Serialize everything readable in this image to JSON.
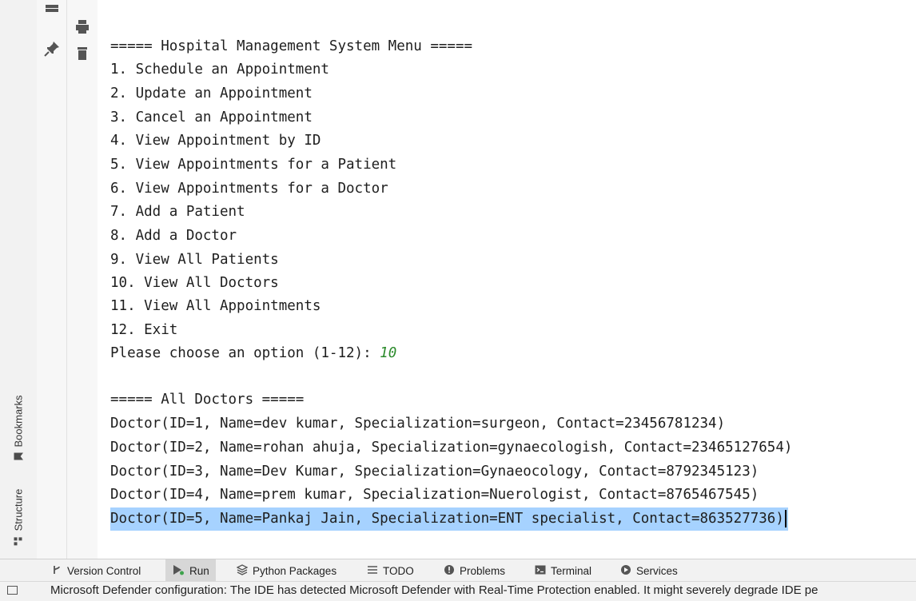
{
  "side_tabs": {
    "bookmarks": "Bookmarks",
    "structure": "Structure"
  },
  "gutter_icons": [
    "layout-icon",
    "pin-icon",
    "print-icon",
    "trash-icon"
  ],
  "console": {
    "lines": [
      {
        "text": "===== Hospital Management System Menu ====="
      },
      {
        "text": "1. Schedule an Appointment"
      },
      {
        "text": "2. Update an Appointment"
      },
      {
        "text": "3. Cancel an Appointment"
      },
      {
        "text": "4. View Appointment by ID"
      },
      {
        "text": "5. View Appointments for a Patient"
      },
      {
        "text": "6. View Appointments for a Doctor"
      },
      {
        "text": "7. Add a Patient"
      },
      {
        "text": "8. Add a Doctor"
      },
      {
        "text": "9. View All Patients"
      },
      {
        "text": "10. View All Doctors"
      },
      {
        "text": "11. View All Appointments"
      },
      {
        "text": "12. Exit"
      },
      {
        "text": "Please choose an option (1-12): ",
        "input": "10"
      },
      {
        "text": ""
      },
      {
        "text": "===== All Doctors ====="
      },
      {
        "text": "Doctor(ID=1, Name=dev kumar, Specialization=surgeon, Contact=23456781234)"
      },
      {
        "text": "Doctor(ID=2, Name=rohan ahuja, Specialization=gynaecologish, Contact=23465127654)"
      },
      {
        "text": "Doctor(ID=3, Name=Dev Kumar, Specialization=Gynaeocology, Contact=8792345123)"
      },
      {
        "text": "Doctor(ID=4, Name=prem kumar, Specialization=Nuerologist, Contact=8765467545)"
      },
      {
        "text": "Doctor(ID=5, Name=Pankaj Jain, Specialization=ENT specialist, Contact=863527736)",
        "selected": true
      }
    ]
  },
  "bottom_tabs": [
    {
      "label": "Version Control",
      "icon": "version-control-icon"
    },
    {
      "label": "Run",
      "icon": "run-icon",
      "active": true
    },
    {
      "label": "Python Packages",
      "icon": "python-packages-icon"
    },
    {
      "label": "TODO",
      "icon": "todo-icon"
    },
    {
      "label": "Problems",
      "icon": "problems-icon"
    },
    {
      "label": "Terminal",
      "icon": "terminal-icon"
    },
    {
      "label": "Services",
      "icon": "services-icon"
    }
  ],
  "status": {
    "text": "Microsoft Defender configuration: The IDE has detected Microsoft Defender with Real-Time Protection enabled. It might severely degrade IDE pe"
  },
  "colors": {
    "selection": "#a6d2ff",
    "user_input": "#2a8a2a",
    "active_tab": "#d7d7d7"
  }
}
